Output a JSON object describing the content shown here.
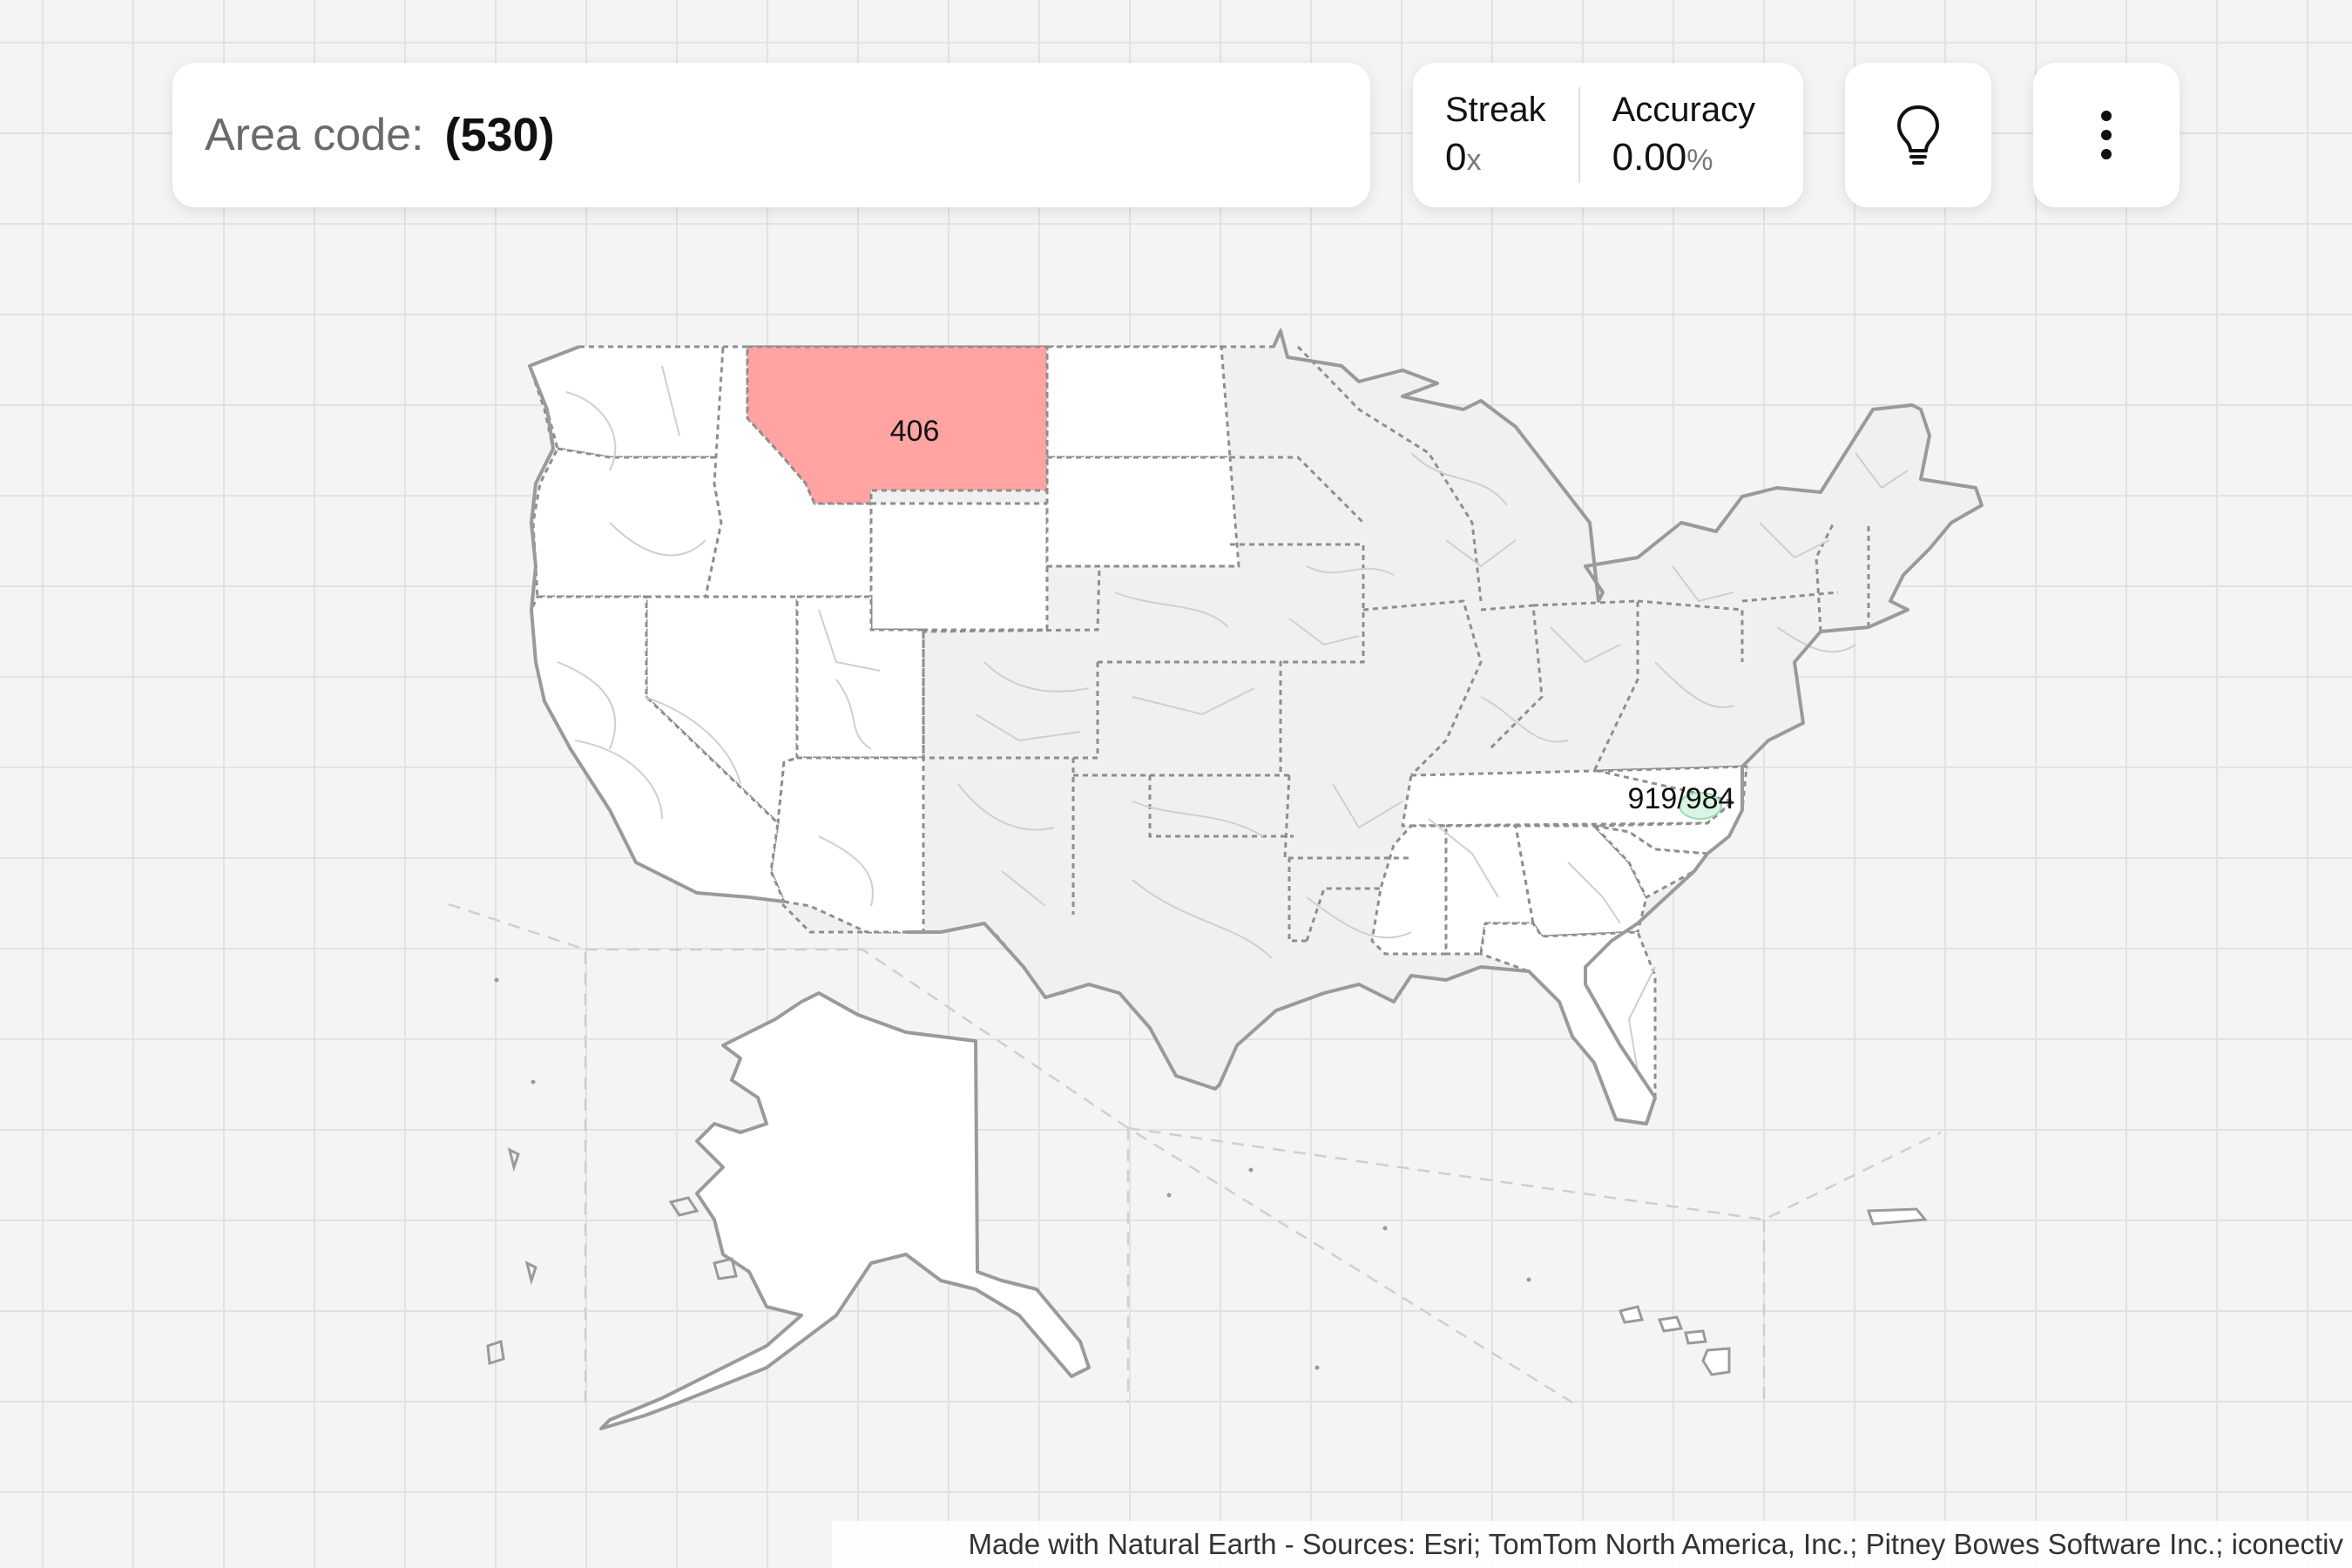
{
  "prompt": {
    "label": "Area code:",
    "value": "(530)"
  },
  "stats": {
    "streak": {
      "label": "Streak",
      "value": "0",
      "unit": "x"
    },
    "accuracy": {
      "label": "Accuracy",
      "value": "0.00",
      "unit": "%"
    }
  },
  "toolbar": {
    "hint_icon": "lightbulb-icon",
    "menu_icon": "more-vertical-icon"
  },
  "map": {
    "labels": {
      "montana": "406",
      "north_carolina": "919/984"
    },
    "colors": {
      "wrong_guess": "#ffa3a3",
      "target_hint": "#d9f5e3",
      "region_fill": "#ffffff",
      "inactive_fill": "#f0f0f0"
    }
  },
  "attribution": "Made with Natural Earth - Sources: Esri; TomTom North America, Inc.; Pitney Bowes Software Inc.; iconectiv"
}
